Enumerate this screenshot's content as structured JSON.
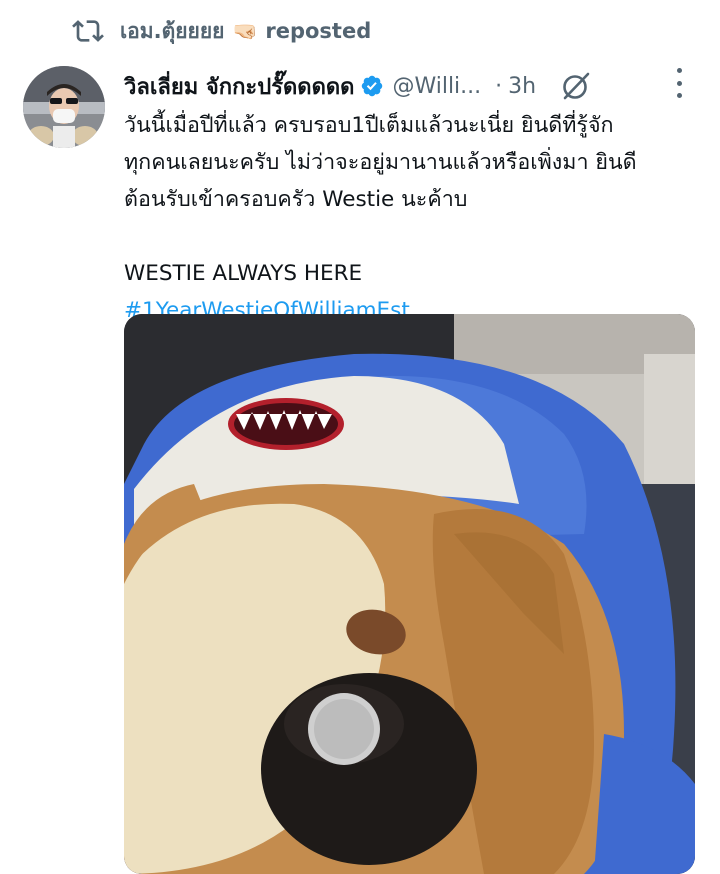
{
  "repost": {
    "user": "เอม.ตุ้ยยยย",
    "emoji": "🤜🏻",
    "label": "reposted"
  },
  "tweet": {
    "author_name": "วิลเลี่ยม จักกะปรั๊ดดดดด",
    "handle": "@Willi...",
    "separator": "·",
    "time": "3h",
    "lines": [
      "วันนี้เมื่อปีที่แล้ว ครบรอบ1ปีเต็มแล้วนะเนี่ย ยินดีที่รู้จัก",
      "ทุกคนเลยนะครับ ไม่ว่าจะอยู่มานานแล้วหรือเพิ่งมา ยินดี",
      "ต้อนรับเข้าครอบครัว Westie นะค้าบ"
    ],
    "line4": "WESTIE ALWAYS HERE",
    "hashtag": "#1YearWestieOfWilliamEst"
  },
  "colors": {
    "accent": "#1d9bf0",
    "text": "#0f1419",
    "secondary": "#536471"
  },
  "icons": [
    "repost-icon",
    "verified-badge-icon",
    "grok-icon",
    "more-options-icon"
  ]
}
